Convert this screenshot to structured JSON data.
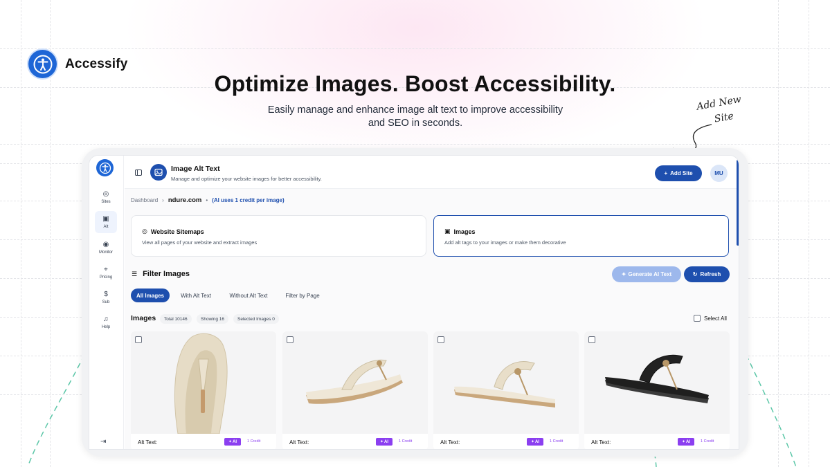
{
  "brand": {
    "name": "Accessify",
    "logo_icon": "accessibility-icon",
    "accent": "#1e66d6"
  },
  "hero": {
    "title": "Optimize Images. Boost Accessibility.",
    "subtitle": "Easily manage and enhance image alt text to improve accessibility and SEO in seconds."
  },
  "annotation": {
    "line1": "Add New",
    "line2": "Site"
  },
  "rail": {
    "items": [
      {
        "label": "Sites",
        "icon": "globe-icon"
      },
      {
        "label": "Alt",
        "icon": "image-icon"
      },
      {
        "label": "Monitor",
        "icon": "target-icon"
      },
      {
        "label": "Pricing",
        "icon": "tag-icon"
      },
      {
        "label": "Sub",
        "icon": "dollar-icon"
      },
      {
        "label": "Help",
        "icon": "headset-icon"
      }
    ],
    "logout_icon": "logout-icon"
  },
  "topbar": {
    "title": "Image Alt Text",
    "description": "Manage and optimize your website images for better accessibility.",
    "add_site": "Add Site",
    "avatar": "MU"
  },
  "breadcrumb": {
    "root": "Dashboard",
    "domain": "ndure.com",
    "note": "(AI uses 1 credit per image)"
  },
  "cards": [
    {
      "title": "Website Sitemaps",
      "desc": "View all pages of your website and extract images",
      "icon": "globe-icon"
    },
    {
      "title": "Images",
      "desc": "Add alt tags to your images or make them decorative",
      "icon": "image-icon"
    }
  ],
  "filter": {
    "title": "Filter Images",
    "generate": "Generate AI Text",
    "refresh": "Refresh",
    "tabs": [
      "All Images",
      "With Alt Text",
      "Without Alt Text",
      "Filter by Page"
    ]
  },
  "images": {
    "title": "Images",
    "total": "Total 10146",
    "showing": "Showing 16",
    "selected": "Selected Images 0",
    "select_all": "Select All",
    "alt_label": "Alt Text:",
    "ai_badge": "AI",
    "credit": "1 Credit"
  },
  "colors": {
    "primary": "#1e4fae",
    "ai": "#8b3ff0",
    "disabled": "#9db8ec"
  }
}
